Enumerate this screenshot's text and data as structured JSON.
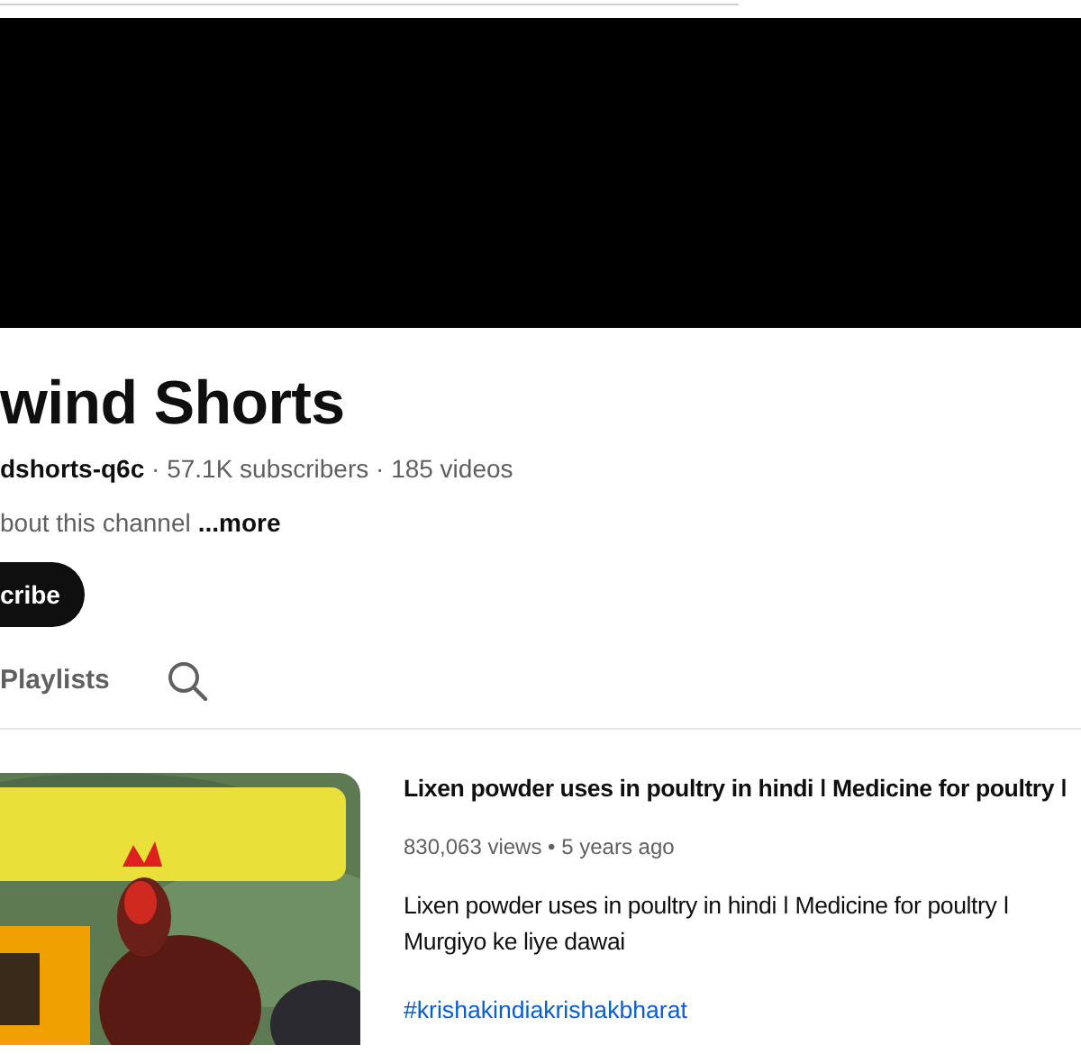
{
  "channel": {
    "name": "wind Shorts",
    "meta": "**dshorts-q6c** · 57.1K subscribers · 185 videos",
    "about": "bout this channel",
    "more": "...more",
    "subscribe": "cribe"
  },
  "tabs": [
    {
      "label": "Playlists",
      "selected": false
    }
  ],
  "video": {
    "title": "Lixen powder uses in poultry in hindi ǀ Medicine for poultry ǀ",
    "meta": "830,063 views • 5 years ago",
    "description": "Lixen powder uses in poultry in hindi ǀ Medicine for poultry ǀ Murgiyo ke liye dawai",
    "hashtag": "#krishakindiakrishakbharat"
  }
}
